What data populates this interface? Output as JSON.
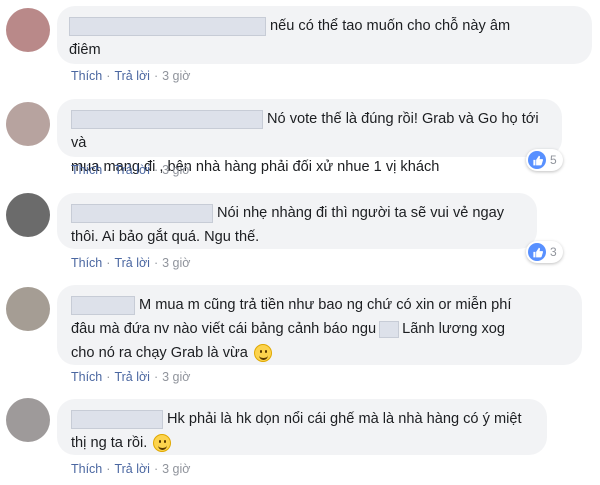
{
  "actions": {
    "like": "Thích",
    "reply": "Trả lời",
    "sep": "·"
  },
  "comments": [
    {
      "avatar_color": "#b98989",
      "text_1": "nếu có thể tao muốn cho chỗ này âm",
      "text_2": "điêm",
      "time": "3 giờ"
    },
    {
      "avatar_color": "#b7a39f",
      "text_1": "Nó vote thế là đúng rồi! Grab và Go họ tới và",
      "text_2": "mua mang đi , bên nhà hàng phải đối xử nhue 1 vị khách",
      "time": "3 giờ",
      "reaction_count": "5"
    },
    {
      "avatar_color": "#6b6b6b",
      "text_1": "Nói nhẹ nhàng đi thì người ta sẽ vui vẻ ngay",
      "text_2": "thôi. Ai bảo gắt quá. Ngu thế.",
      "time": "3 giờ",
      "reaction_count": "3"
    },
    {
      "avatar_color": "#a59d94",
      "text_1": "M mua m cũng trả tiền như bao ng chứ có xin or miễn phí",
      "text_2a": "đâu mà đứa nv nào viết cái bảng cảnh báo ngu",
      "text_2b": "Lãnh lương xog",
      "text_3": "cho nó ra chạy Grab là vừa",
      "time": "3 giờ"
    },
    {
      "avatar_color": "#9e9a9a",
      "text_1": "Hk phải là hk dọn nổi cái ghế mà là nhà hàng có ý miệt",
      "text_2": "thị ng ta rồi.",
      "time": "3 giờ"
    }
  ]
}
